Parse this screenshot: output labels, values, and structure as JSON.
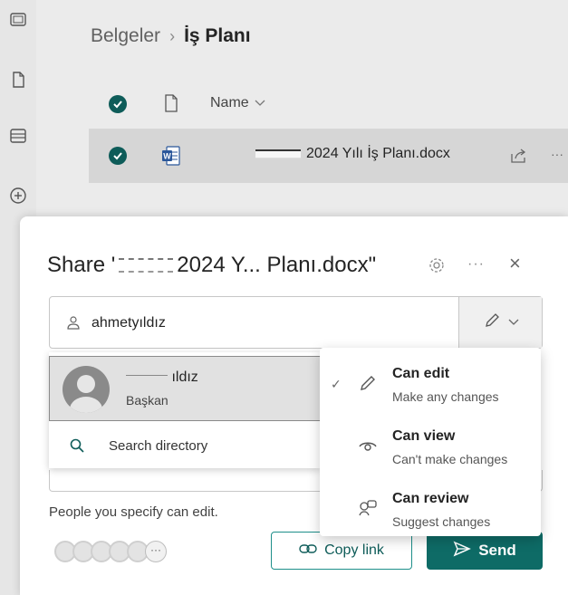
{
  "breadcrumb": {
    "root": "Belgeler",
    "separator": "›",
    "current": "İş Planı"
  },
  "file_list": {
    "name_header": "Name",
    "sort_icon": "chevron-down-icon",
    "selected_file": "2024 Yılı İş Planı.docx",
    "more_label": "···"
  },
  "share_dialog": {
    "title_prefix": "Share '",
    "title_suffix": "2024 Y... Planı.docx\"",
    "more_label": "···",
    "close_label": "×",
    "people_input_value": "ahmetyıldız",
    "suggestion": {
      "name": "ıldız",
      "title": "Başkan"
    },
    "search_directory_label": "Search directory",
    "people_note": "People you specify can edit.",
    "more_people_label": "···",
    "copy_link_label": "Copy link",
    "send_label": "Send"
  },
  "permission_menu": {
    "check_mark": "✓",
    "options": [
      {
        "label": "Can edit",
        "description": "Make any changes",
        "icon": "pencil-icon",
        "selected": true
      },
      {
        "label": "Can view",
        "description": "Can't make changes",
        "icon": "eye-icon",
        "selected": false
      },
      {
        "label": "Can review",
        "description": "Suggest changes",
        "icon": "review-icon",
        "selected": false
      }
    ]
  },
  "colors": {
    "accent": "#0e6b66",
    "accent_dark": "#0e5c59",
    "selected_row": "#d6d6d6"
  }
}
